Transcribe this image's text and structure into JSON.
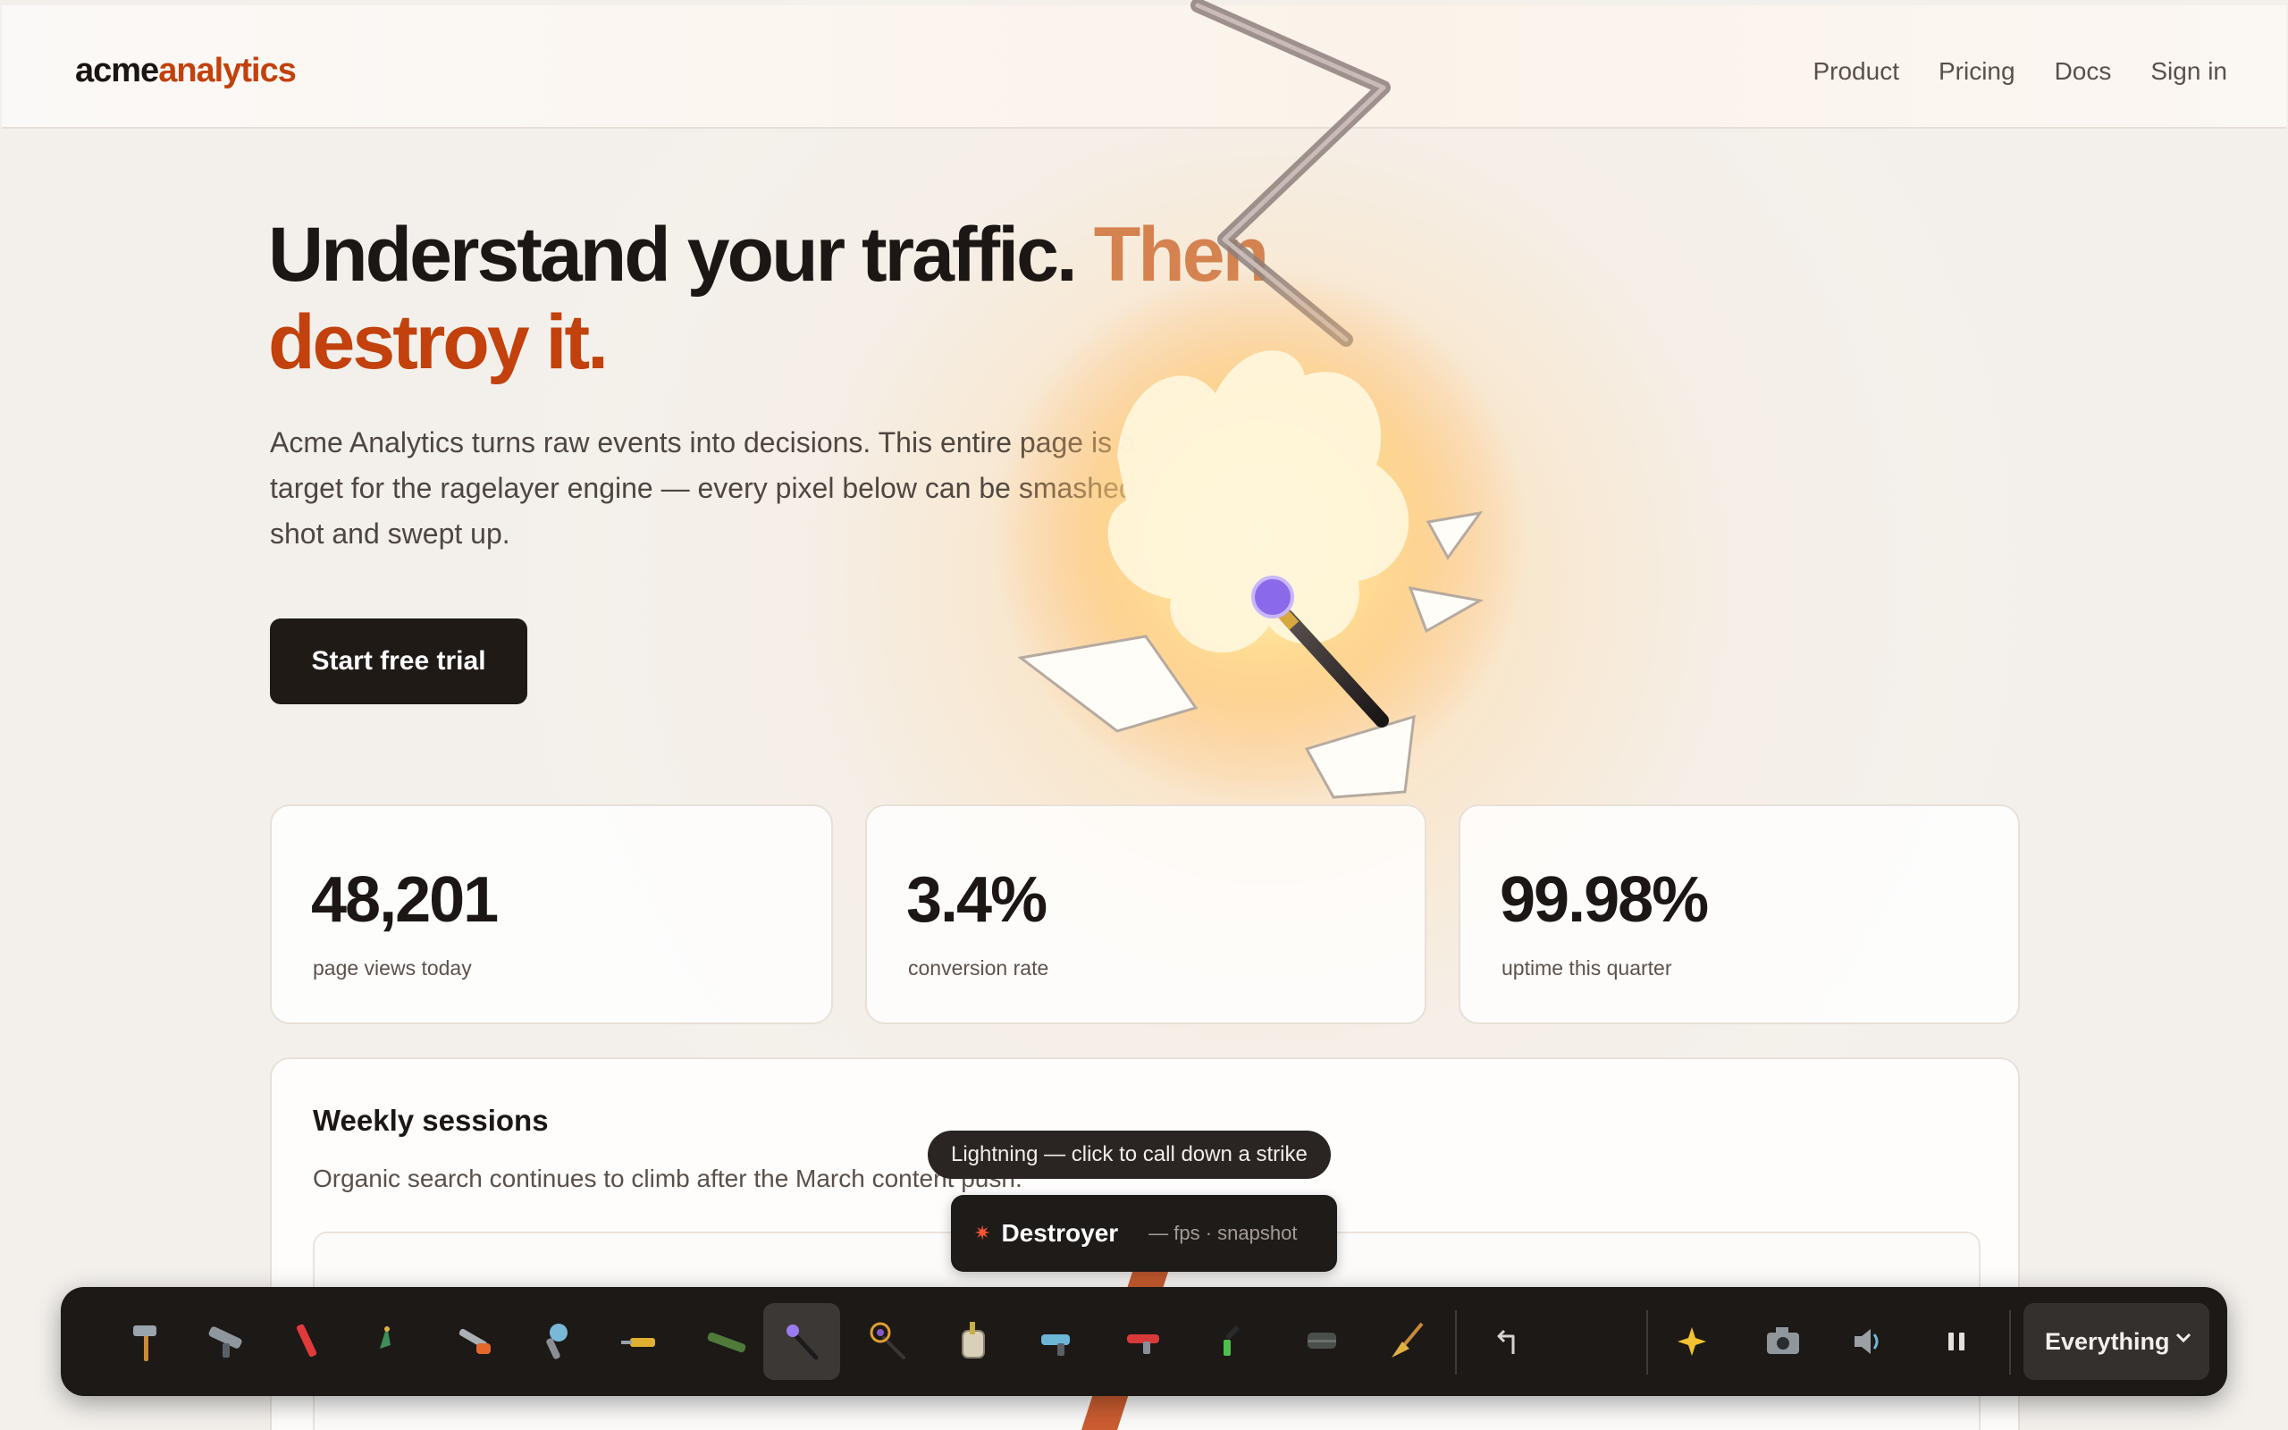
{
  "brand": {
    "part1": "acme",
    "part2": "analytics"
  },
  "nav": {
    "links": [
      "Product",
      "Pricing",
      "Docs",
      "Sign in"
    ]
  },
  "hero": {
    "title_main": "Understand your traffic.",
    "title_accent_1": "Then",
    "title_accent_2": "destroy it.",
    "subtitle_line1": "Acme Analytics turns raw events into decisions. This entire page is a",
    "subtitle_line2": "target for the ragelayer engine — every pixel below can be smashed,",
    "subtitle_line3": "shot and swept up.",
    "cta": "Start free trial"
  },
  "stats": [
    {
      "value": "48,201",
      "label": "page views today"
    },
    {
      "value": "3.4%",
      "label": "conversion rate"
    },
    {
      "value": "99.98%",
      "label": "uptime this quarter"
    }
  ],
  "sessions": {
    "title": "Weekly sessions",
    "subtitle": "Organic search continues to climb after the March content push."
  },
  "tooltip": "Lightning — click to call down a strike",
  "status": {
    "name": "Destroyer",
    "meta": "— fps · snapshot"
  },
  "toolbar": {
    "tools": [
      {
        "name": "hammer-icon",
        "active": false
      },
      {
        "name": "gun-icon",
        "active": false
      },
      {
        "name": "marker-icon",
        "active": false
      },
      {
        "name": "feather-icon",
        "active": false
      },
      {
        "name": "chainsaw-icon",
        "active": false
      },
      {
        "name": "flamethrower-icon",
        "active": false
      },
      {
        "name": "drill-icon",
        "active": false
      },
      {
        "name": "bazooka-icon",
        "active": false
      },
      {
        "name": "lightning-wand-icon",
        "active": true
      },
      {
        "name": "vortex-wand-icon",
        "active": false
      },
      {
        "name": "acid-jar-icon",
        "active": false
      },
      {
        "name": "freeze-gun-icon",
        "active": false
      },
      {
        "name": "laser-gun-icon",
        "active": false
      },
      {
        "name": "spray-can-icon",
        "active": false
      },
      {
        "name": "eraser-icon",
        "active": false
      },
      {
        "name": "broom-icon",
        "active": false
      }
    ],
    "undo": "undo-icon",
    "extras": [
      "sparkles-icon",
      "camera-icon",
      "speaker-icon",
      "pause-icon"
    ],
    "scope_select": "Everything"
  },
  "colors": {
    "accent": "#c2410c",
    "dark": "#1c1917",
    "toolbar": "#1c1917"
  }
}
